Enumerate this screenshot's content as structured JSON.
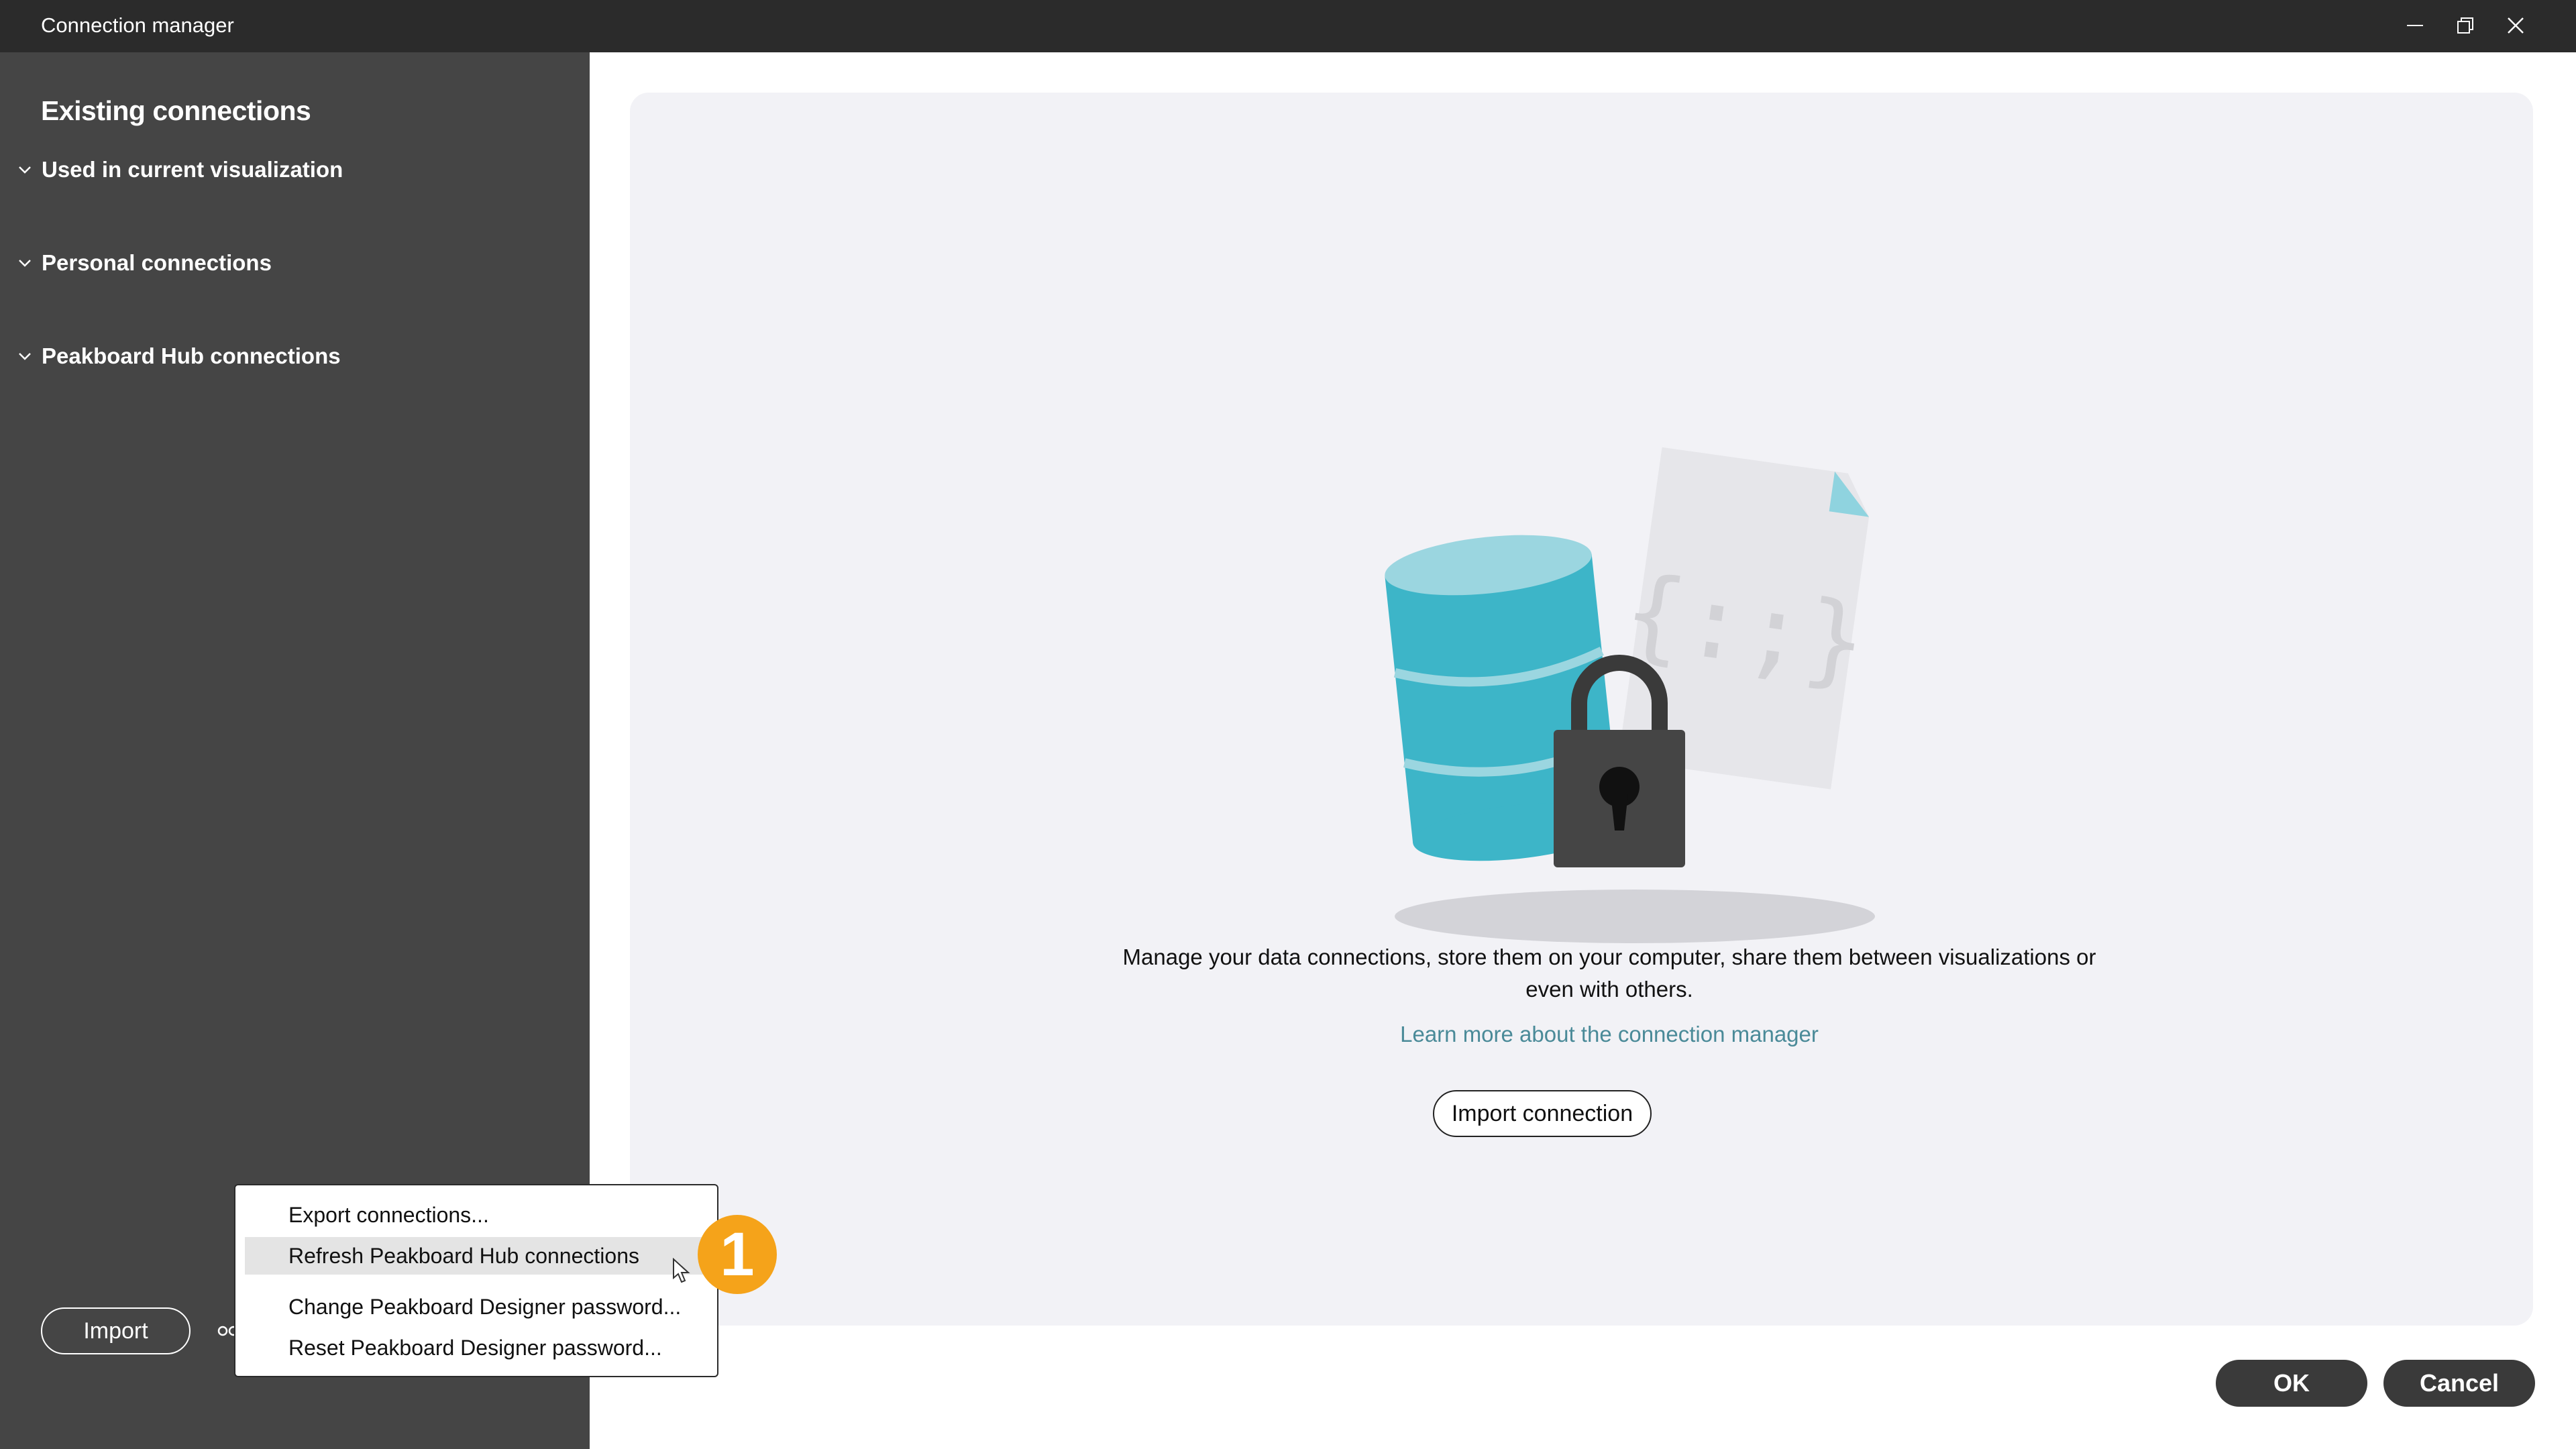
{
  "window": {
    "title": "Connection manager"
  },
  "sidebar": {
    "heading": "Existing connections",
    "groups": [
      {
        "label": "Used in current visualization"
      },
      {
        "label": "Personal connections"
      },
      {
        "label": "Peakboard Hub connections"
      }
    ],
    "import_label": "Import"
  },
  "main": {
    "description": "Manage your data connections, store them on your computer, share them between visualizations or even with others.",
    "learn_more": "Learn more about the connection manager",
    "import_connection_label": "Import connection",
    "illustration_code_text": "{:;}"
  },
  "context_menu": {
    "items": [
      {
        "label": "Export connections..."
      },
      {
        "label": "Refresh Peakboard Hub connections"
      },
      {
        "label": "Change Peakboard Designer password..."
      },
      {
        "label": "Reset Peakboard Designer password..."
      }
    ],
    "highlighted_index": 1
  },
  "footer": {
    "ok_label": "OK",
    "cancel_label": "Cancel"
  },
  "annotation": {
    "step_number": "1"
  },
  "colors": {
    "titlebar": "#2b2b2b",
    "sidebar": "#454545",
    "panel": "#f2f2f6",
    "accent_teal": "#3db5c8",
    "link": "#4a8a98",
    "badge": "#f5a31a"
  }
}
